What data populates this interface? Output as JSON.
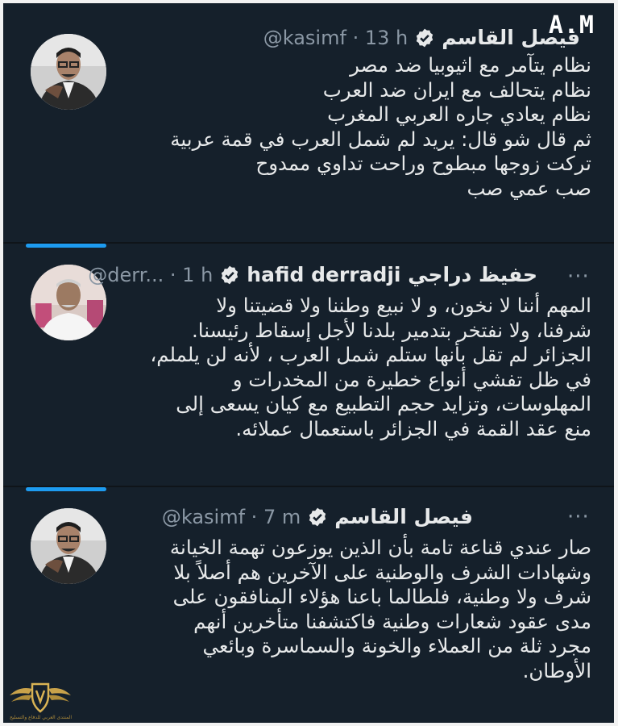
{
  "overlay": {
    "label": "A.M"
  },
  "tweets": [
    {
      "name": "فيصل القاسم",
      "handle": "@kasimf",
      "time": "13 h",
      "lines": [
        "نظام  يتآمر مع اثيوبيا ضد مصر",
        "نظام يتحالف مع ايران ضد العرب",
        "نظام يعادي جاره العربي المغرب",
        "ثم قال شو قال: يريد لم شمل العرب في قمة عربية",
        "تركت زوجها مبطوح وراحت تداوي ممدوح",
        "صب عمي صب"
      ]
    },
    {
      "name": "hafid derradji حفيظ دراجي",
      "handle": "@derr...",
      "time": "1 h",
      "more": "···",
      "lines": [
        "المهم أننا لا نخون، و لا نبيع وطننا ولا قضيتنا ولا",
        "شرفنا، ولا نفتخر بتدمير بلدنا لأجل إسقاط رئيسنا.",
        "الجزائر لم تقل بأنها ستلم شمل العرب ، لأنه لن يلملم،",
        "في ظل تفشي أنواع خطيرة من المخدرات و",
        "المهلوسات، وتزايد حجم التطبيع مع كيان يسعى إلى",
        "منع عقد القمة في الجزائر باستعمال عملائه."
      ]
    },
    {
      "name": "فيصل القاسم",
      "handle": "@kasimf",
      "time": "7 m",
      "more": "···",
      "lines": [
        "صار عندي قناعة تامة بأن الذين يوزعون تهمة الخيانة",
        "وشهادات الشرف والوطنية على الآخرين هم أصلاً بلا",
        "شرف ولا وطنية، فلطالما باعنا هؤلاء المنافقون على",
        "مدى عقود شعارات وطنية فاكتشفنا متأخرين أنهم",
        "مجرد ثلة من العملاء والخونة والسماسرة وبائعي",
        "الأوطان."
      ]
    }
  ],
  "separator": "·",
  "watermark": {
    "text": "المنتدى العربي للدفاع والتسليح"
  },
  "colors": {
    "background": "#15202b",
    "accent": "#1d9bf0",
    "muted": "#8b98a5",
    "text": "#e7e9ea"
  }
}
